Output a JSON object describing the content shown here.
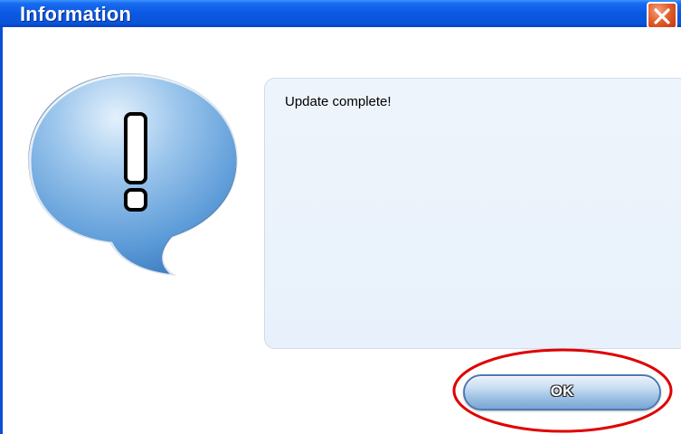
{
  "window": {
    "title": "Information",
    "close_icon": "close-icon"
  },
  "content": {
    "icon": "exclamation-speech-bubble-icon",
    "message": "Update complete!"
  },
  "buttons": {
    "ok_label": "OK"
  },
  "annotation": {
    "type": "red-ellipse-highlight",
    "target": "ok-button",
    "color": "#e00000"
  },
  "colors": {
    "titlebar": "#0a58e2",
    "close_button": "#e3622f",
    "message_bg": "#eef4fb",
    "bubble": "#5b9ad8"
  }
}
